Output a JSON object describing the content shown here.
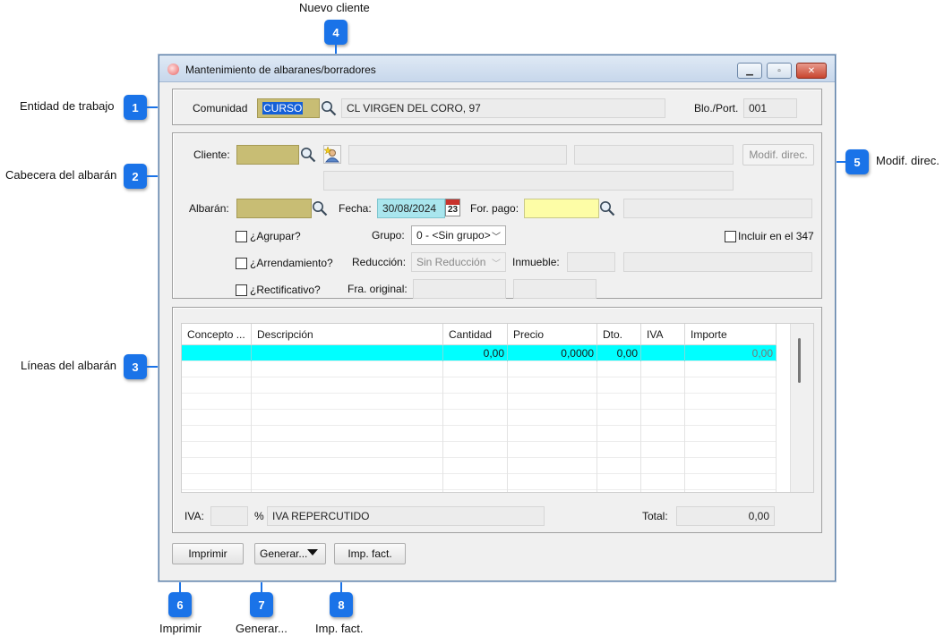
{
  "window": {
    "title": "Mantenimiento de albaranes/borradores"
  },
  "entity": {
    "comunidad_label": "Comunidad",
    "comunidad_value": "CURSO",
    "address": "CL VIRGEN DEL CORO, 97",
    "bloport_label": "Blo./Port.",
    "bloport_value": "001"
  },
  "header": {
    "cliente_label": "Cliente:",
    "cliente_value": "",
    "modif_direc_label": "Modif. direc.",
    "albaran_label": "Albarán:",
    "fecha_label": "Fecha:",
    "fecha_value": "30/08/2024",
    "calendar_day": "23",
    "forpago_label": "For. pago:",
    "agrupar_label": "¿Agrupar?",
    "grupo_label": "Grupo:",
    "grupo_value": "0 - <Sin grupo>",
    "incluir347_label": "Incluir en el 347",
    "arrendamiento_label": "¿Arrendamiento?",
    "reduccion_label": "Reducción:",
    "reduccion_value": "Sin Reducción",
    "inmueble_label": "Inmueble:",
    "rectificativo_label": "¿Rectificativo?",
    "fra_original_label": "Fra. original:"
  },
  "lines": {
    "columns": [
      "Concepto ...",
      "Descripción",
      "Cantidad",
      "Precio",
      "Dto.",
      "IVA",
      "Importe"
    ],
    "rows": [
      {
        "concepto": "",
        "descripcion": "",
        "cantidad": "0,00",
        "precio": "0,0000",
        "dto": "0,00",
        "iva": "",
        "importe": "0,00"
      }
    ]
  },
  "footer": {
    "iva_label": "IVA:",
    "percent": "%",
    "iva_desc": "IVA REPERCUTIDO",
    "total_label": "Total:",
    "total_value": "0,00"
  },
  "buttons": {
    "imprimir": "Imprimir",
    "generar": "Generar...",
    "imp_fact": "Imp. fact."
  },
  "callouts": [
    {
      "n": "1",
      "label": "Entidad de trabajo"
    },
    {
      "n": "2",
      "label": "Cabecera del albarán"
    },
    {
      "n": "3",
      "label": "Líneas del albarán"
    },
    {
      "n": "4",
      "label": "Nuevo cliente"
    },
    {
      "n": "5",
      "label": "Modif. direc."
    },
    {
      "n": "6",
      "label": "Imprimir"
    },
    {
      "n": "7",
      "label": "Generar..."
    },
    {
      "n": "8",
      "label": "Imp. fact."
    }
  ],
  "colors": {
    "callout": "#1a73e8",
    "olive_field": "#c8bd74",
    "yellow_field": "#fdfda6",
    "selected_row": "#00ffff",
    "date_field": "#a9e6ee"
  }
}
